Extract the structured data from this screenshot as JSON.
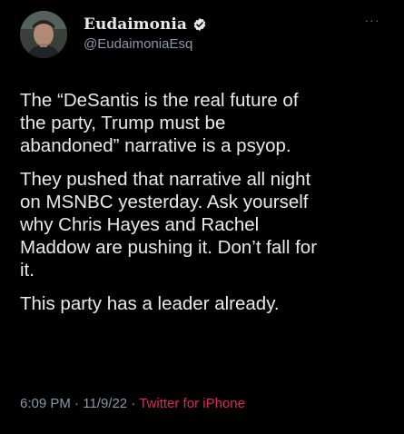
{
  "tweet": {
    "display_name": "Eudaimonia",
    "handle": "@EudaimoniaEsq",
    "verified_icon": "verified-badge-icon",
    "more_icon": "more-options-icon",
    "more_label": "···",
    "paragraphs": [
      "The “DeSantis is the real future of\nthe party, Trump must be\nabandoned” narrative is a psyop.",
      "They pushed that narrative all night\non MSNBC yesterday. Ask yourself\nwhy Chris Hayes and Rachel\nMaddow are pushing it. Don’t fall for\nit.",
      "This party has a leader already."
    ],
    "time": "6:09 PM",
    "date": "11/9/22",
    "separator": " · ",
    "source": "Twitter for iPhone"
  },
  "colors": {
    "background": "#000000",
    "text": "#e7e9ea",
    "secondary": "#8b98a5",
    "source": "#e0245e"
  }
}
